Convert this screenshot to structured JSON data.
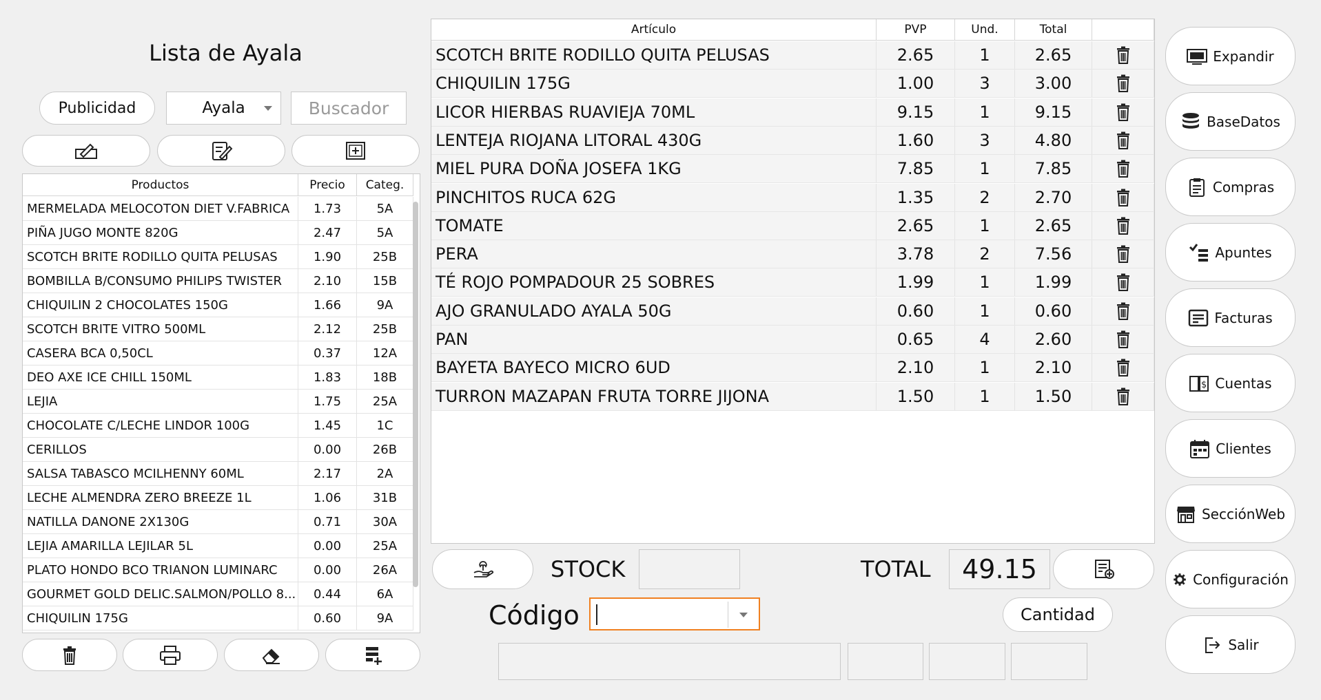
{
  "title": "Lista de Ayala",
  "filters": {
    "publicidad_label": "Publicidad",
    "selected_list": "Ayala",
    "search_placeholder": "Buscador"
  },
  "products": {
    "columns": [
      "Productos",
      "Precio",
      "Categ."
    ],
    "rows": [
      {
        "name": "MERMELADA MELOCOTON DIET V.FABRICA",
        "price": "1.73",
        "cat": "5A"
      },
      {
        "name": "PIÑA JUGO MONTE 820G",
        "price": "2.47",
        "cat": "5A"
      },
      {
        "name": "SCOTCH BRITE RODILLO QUITA PELUSAS",
        "price": "1.90",
        "cat": "25B"
      },
      {
        "name": "BOMBILLA B/CONSUMO PHILIPS TWISTER",
        "price": "2.10",
        "cat": "15B"
      },
      {
        "name": "CHIQUILIN 2 CHOCOLATES 150G",
        "price": "1.66",
        "cat": "9A"
      },
      {
        "name": "SCOTCH BRITE VITRO 500ML",
        "price": "2.12",
        "cat": "25B"
      },
      {
        "name": "CASERA BCA 0,50CL",
        "price": "0.37",
        "cat": "12A"
      },
      {
        "name": "DEO AXE ICE CHILL 150ML",
        "price": "1.83",
        "cat": "18B"
      },
      {
        "name": "LEJIA",
        "price": "1.75",
        "cat": "25A"
      },
      {
        "name": "CHOCOLATE C/LECHE  LINDOR 100G",
        "price": "1.45",
        "cat": "1C"
      },
      {
        "name": "CERILLOS",
        "price": "0.00",
        "cat": "26B"
      },
      {
        "name": "SALSA TABASCO MCILHENNY 60ML",
        "price": "2.17",
        "cat": "2A"
      },
      {
        "name": "LECHE ALMENDRA ZERO BREEZE 1L",
        "price": "1.06",
        "cat": "31B"
      },
      {
        "name": "NATILLA DANONE 2X130G",
        "price": "0.71",
        "cat": "30A"
      },
      {
        "name": "LEJIA AMARILLA  LEJILAR 5L",
        "price": "0.00",
        "cat": "25A"
      },
      {
        "name": "PLATO HONDO BCO TRIANON LUMINARC",
        "price": "0.00",
        "cat": "26A"
      },
      {
        "name": "GOURMET GOLD DELIC.SALMON/POLLO 8...",
        "price": "0.44",
        "cat": "6A"
      },
      {
        "name": "CHIQUILIN 175G",
        "price": "0.60",
        "cat": "9A"
      }
    ]
  },
  "cart": {
    "columns": [
      "Artículo",
      "PVP",
      "Und.",
      "Total",
      ""
    ],
    "rows": [
      {
        "name": "SCOTCH BRITE RODILLO QUITA PELUSAS",
        "pvp": "2.65",
        "und": "1",
        "total": "2.65"
      },
      {
        "name": "CHIQUILIN 175G",
        "pvp": "1.00",
        "und": "3",
        "total": "3.00"
      },
      {
        "name": "LICOR HIERBAS RUAVIEJA 70ML",
        "pvp": "9.15",
        "und": "1",
        "total": "9.15"
      },
      {
        "name": "LENTEJA RIOJANA LITORAL 430G",
        "pvp": "1.60",
        "und": "3",
        "total": "4.80"
      },
      {
        "name": "MIEL PURA DOÑA JOSEFA 1KG",
        "pvp": "7.85",
        "und": "1",
        "total": "7.85"
      },
      {
        "name": "PINCHITOS RUCA 62G",
        "pvp": "1.35",
        "und": "2",
        "total": "2.70"
      },
      {
        "name": "TOMATE",
        "pvp": "2.65",
        "und": "1",
        "total": "2.65"
      },
      {
        "name": "PERA",
        "pvp": "3.78",
        "und": "2",
        "total": "7.56"
      },
      {
        "name": "TÉ ROJO POMPADOUR 25 SOBRES",
        "pvp": "1.99",
        "und": "1",
        "total": "1.99"
      },
      {
        "name": "AJO GRANULADO AYALA 50G",
        "pvp": "0.60",
        "und": "1",
        "total": "0.60"
      },
      {
        "name": "PAN",
        "pvp": "0.65",
        "und": "4",
        "total": "2.60"
      },
      {
        "name": "BAYETA BAYECO MICRO 6UD",
        "pvp": "2.10",
        "und": "1",
        "total": "2.10"
      },
      {
        "name": "TURRON MAZAPAN FRUTA TORRE JIJONA",
        "pvp": "1.50",
        "und": "1",
        "total": "1.50"
      }
    ]
  },
  "bottom": {
    "stock_label": "STOCK",
    "total_label": "TOTAL",
    "total_value": "49.15",
    "codigo_label": "Código",
    "cantidad_label": "Cantidad"
  },
  "sidebar": {
    "expandir": "Expandir",
    "basedatos": "BaseDatos",
    "compras": "Compras",
    "apuntes": "Apuntes",
    "facturas": "Facturas",
    "cuentas": "Cuentas",
    "clientes": "Clientes",
    "seccionweb": "SecciónWeb",
    "configuracion": "Configuración",
    "salir": "Salir"
  }
}
